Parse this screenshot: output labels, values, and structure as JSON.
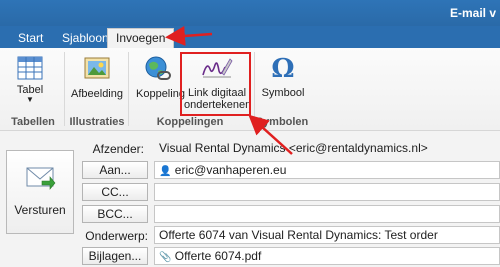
{
  "window": {
    "title": "E-mail v"
  },
  "tabs": [
    {
      "label": "Start"
    },
    {
      "label": "Sjabloon"
    },
    {
      "label": "Invoegen"
    }
  ],
  "ribbon": {
    "buttons": [
      {
        "label": "Tabel",
        "icon": "table-icon"
      },
      {
        "label": "Afbeelding",
        "icon": "picture-icon"
      },
      {
        "label": "Koppeling",
        "icon": "globe-link-icon"
      },
      {
        "label": "Link digitaal ondertekenen",
        "line1": "Link digitaal",
        "line2": "ondertekenen",
        "icon": "signature-pen-icon"
      },
      {
        "label": "Symbool",
        "icon": "omega-icon"
      }
    ],
    "groups": [
      {
        "label": "Tabellen"
      },
      {
        "label": "Illustraties"
      },
      {
        "label": "Koppelingen"
      },
      {
        "label": "Symbolen"
      }
    ]
  },
  "compose": {
    "send_label": "Versturen",
    "from_label": "Afzender:",
    "from_value": "Visual Rental Dynamics <eric@rentaldynamics.nl>",
    "to_button": "Aan...",
    "to_value": "eric@vanhaperen.eu",
    "cc_button": "CC...",
    "cc_value": "",
    "bcc_button": "BCC...",
    "bcc_value": "",
    "subject_label": "Onderwerp:",
    "subject_value": "Offerte 6074 van Visual Rental Dynamics: Test order",
    "attach_button": "Bijlagen...",
    "attach_value": "Offerte 6074.pdf"
  },
  "colors": {
    "titlebar": "#2e74b7",
    "annotation_red": "#e02020"
  }
}
